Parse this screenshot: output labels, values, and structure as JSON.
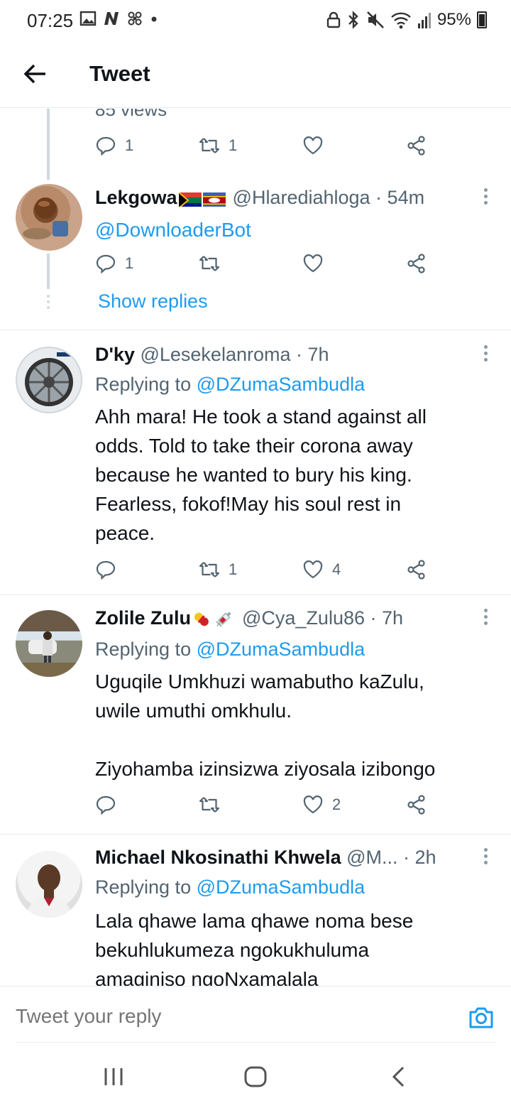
{
  "status_bar": {
    "time": "07:25",
    "battery": "95%",
    "left_icons": [
      "image-icon",
      "n-icon",
      "fan-icon",
      "dot-icon"
    ],
    "right_icons": [
      "lock-icon",
      "bluetooth-icon",
      "mute-icon",
      "wifi-icon",
      "signal-icon",
      "battery-icon"
    ]
  },
  "header": {
    "title": "Tweet",
    "back_icon": "arrow-left-icon"
  },
  "prev_tweet": {
    "views": "85 views",
    "reply_count": "1",
    "retweet_count": "1"
  },
  "tweets": [
    {
      "name": "Lekgowa",
      "handle": "@Hlarediahloga · 54m",
      "text": "@DownloaderBot",
      "reply_count": "1",
      "retweet_count": "",
      "like_count": "",
      "show_replies": "Show replies",
      "flags": [
        "south-africa-flag",
        "eswatini-flag"
      ]
    },
    {
      "name": "D'ky",
      "handle": "@Lesekelanroma · 7h",
      "replying_prefix": "Replying to ",
      "replying_to": "@DZumaSambudla",
      "text": "Ahh mara! He took a stand against all\nodds. Told to take their corona away\nbecause he wanted to bury his king.\nFearless, fokof!May his soul rest in\npeace.",
      "reply_count": "",
      "retweet_count": "1",
      "like_count": "4"
    },
    {
      "name": "Zolile Zulu",
      "handle": "@Cya_Zulu86 · 7h",
      "replying_prefix": "Replying to ",
      "replying_to": "@DZumaSambudla",
      "text": "Uguqile Umkhuzi wamabutho kaZulu,\nuwile umuthi omkhulu.\n\nZiyohamba izinsizwa ziyosala izibongo",
      "reply_count": "",
      "retweet_count": "",
      "like_count": "2",
      "emojis": [
        "pill-emoji",
        "syringe-emoji"
      ]
    },
    {
      "name": "Michael Nkosinathi Khwela",
      "handle": "@M... · 2h",
      "replying_prefix": "Replying to ",
      "replying_to": "@DZumaSambudla",
      "text": "Lala qhawe lama qhawe noma bese\nbekuhlukumeza ngokukhuluma\namaginiso ngoNxamalala"
    }
  ],
  "reply_bar": {
    "placeholder": "Tweet your reply",
    "camera_icon": "camera-icon"
  },
  "nav_bar": {
    "icons": [
      "recents-icon",
      "home-icon",
      "back-icon"
    ]
  },
  "colors": {
    "accent": "#1d9bf0",
    "secondary_text": "#536471",
    "divider": "#e6ecf0"
  }
}
